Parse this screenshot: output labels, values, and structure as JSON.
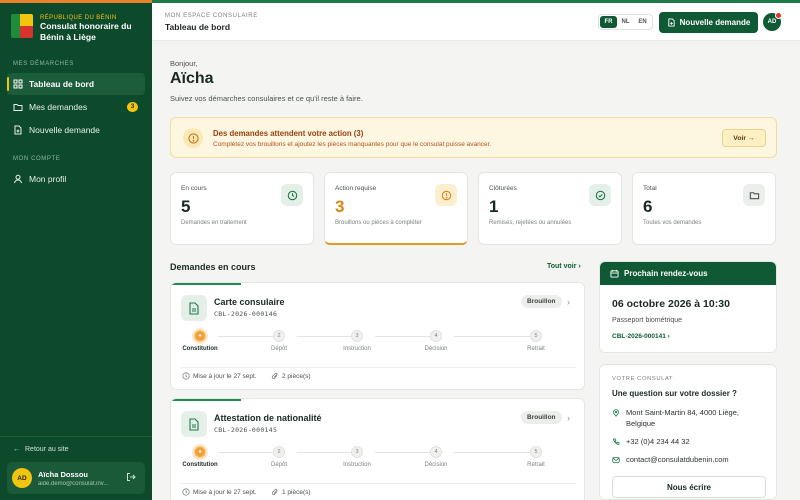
{
  "sidebar": {
    "brand_kicker": "République du Bénin",
    "brand_name": "Consulat honoraire du Bénin à Liège",
    "section_demarches": "Mes démarches",
    "items": [
      {
        "label": "Tableau de bord",
        "active": true
      },
      {
        "label": "Mes demandes",
        "badge": "3"
      },
      {
        "label": "Nouvelle demande"
      }
    ],
    "section_compte": "Mon compte",
    "profile_label": "Mon profil",
    "back_link": "Retour au site",
    "user": {
      "initials": "AD",
      "name": "Aïcha Dossou",
      "email": "aide.demo@consulat.inv..."
    }
  },
  "header": {
    "crumb": "Mon espace consulaire",
    "title": "Tableau de bord",
    "languages": [
      "FR",
      "NL",
      "EN"
    ],
    "active_language": "FR",
    "new_request_label": "Nouvelle demande",
    "avatar_initials": "AD"
  },
  "greeting": {
    "hello": "Bonjour,",
    "name": "Aïcha",
    "subtitle": "Suivez vos démarches consulaires et ce qu'il reste à faire."
  },
  "alert": {
    "title": "Des demandes attendent votre action (3)",
    "description": "Complétez vos brouillons et ajoutez les pièces manquantes pour que le consulat puisse avancer.",
    "button_label": "Voir →"
  },
  "stats": [
    {
      "label": "En cours",
      "value": "5",
      "sub": "Demandes en traitement"
    },
    {
      "label": "Action requise",
      "value": "3",
      "sub": "Brouillons ou pièces à compléter"
    },
    {
      "label": "Clôturées",
      "value": "1",
      "sub": "Remises, rejetées ou annulées"
    },
    {
      "label": "Total",
      "value": "6",
      "sub": "Toutes vos demandes"
    }
  ],
  "requests_section": {
    "title": "Demandes en cours",
    "see_all": "Tout voir ›"
  },
  "steps": [
    "Constitution",
    "Dépôt",
    "Instruction",
    "Décision",
    "Retrait"
  ],
  "requests": [
    {
      "title": "Carte consulaire",
      "ref": "CBL-2026-000146",
      "status": "Brouillon",
      "current_step": 1,
      "updated": "Mise à jour le 27 sept.",
      "pieces": "2 pièce(s)"
    },
    {
      "title": "Attestation de nationalité",
      "ref": "CBL-2026-000145",
      "status": "Brouillon",
      "current_step": 1,
      "updated": "Mise à jour le 27 sept.",
      "pieces": "1 pièce(s)"
    }
  ],
  "appointment": {
    "header": "Prochain rendez-vous",
    "date": "06 octobre 2026 à 10:30",
    "kind": "Passeport biométrique",
    "ref": "CBL-2026-000141 ›"
  },
  "consulat": {
    "kicker": "Votre consulat",
    "question": "Une question sur votre dossier ?",
    "address": "Mont Saint-Martin 84, 4000 Liège, Belgique",
    "phone": "+32 (0)4 234 44 32",
    "email": "contact@consulatdubenin.com",
    "write_label": "Nous écrire"
  },
  "colors": {
    "brand_green": "#0f5a34",
    "sidebar_bg": "#0d4a2b",
    "accent_yellow": "#f1c40f",
    "alert_orange": "#d98612"
  }
}
